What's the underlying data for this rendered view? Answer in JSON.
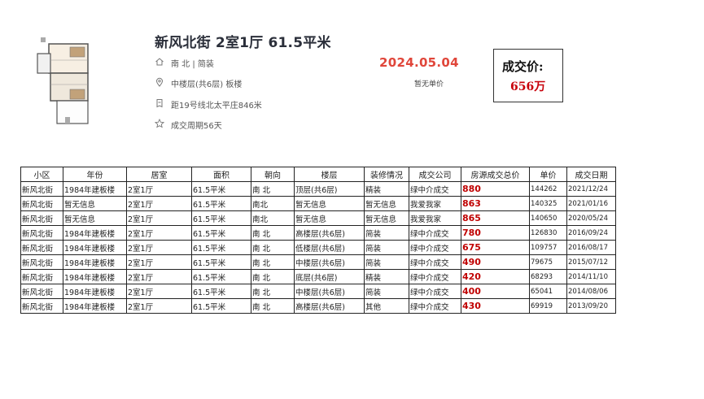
{
  "listing": {
    "title": "新风北街 2室1厅 61.5平米",
    "orientation": "南 北 | 简装",
    "floor": "中楼层(共6层) 板楼",
    "subway": "距19号线北太平庄846米",
    "cycle": "成交周期56天",
    "deal_date": "2024.05.04",
    "unit_price": "暂无单价",
    "price_label": "成交价:",
    "price_value": "656万",
    "icons": [
      "home-icon",
      "location-icon",
      "subway-icon",
      "star-icon"
    ]
  },
  "table": {
    "headers": [
      "小区",
      "年份",
      "居室",
      "面积",
      "朝向",
      "楼层",
      "装修情况",
      "成交公司",
      "房源成交总价",
      "单价",
      "成交日期"
    ],
    "rows": [
      [
        "新风北街",
        "1984年建板楼",
        "2室1厅",
        "61.5平米",
        "南 北",
        "顶层(共6层)",
        "精装",
        "绿中介成交",
        "880",
        "144262",
        "2021/12/24"
      ],
      [
        "新风北街",
        "暂无信息",
        "2室1厅",
        " 61.5平米",
        " 南北",
        "暂无信息",
        "暂无信息",
        "我爱我家",
        "863",
        "140325",
        "2021/01/16"
      ],
      [
        "新风北街",
        "暂无信息",
        "2室1厅",
        " 61.5平米",
        " 南北",
        "暂无信息",
        "暂无信息",
        "我爱我家",
        "865",
        "140650",
        "2020/05/24"
      ],
      [
        "新风北街",
        "1984年建板楼",
        "2室1厅",
        "61.5平米",
        "南 北",
        "高楼层(共6层)",
        "简装",
        "绿中介成交",
        "780",
        "126830",
        "2016/09/24"
      ],
      [
        "新风北街",
        "1984年建板楼",
        "2室1厅",
        "61.5平米",
        "南 北",
        "低楼层(共6层)",
        "简装",
        "绿中介成交",
        "675",
        "109757",
        "2016/08/17"
      ],
      [
        "新风北街",
        "1984年建板楼",
        "2室1厅",
        "61.5平米",
        "南 北",
        "中楼层(共6层)",
        "简装",
        "绿中介成交",
        "490",
        "79675",
        "2015/07/12"
      ],
      [
        "新风北街",
        "1984年建板楼",
        "2室1厅",
        "61.5平米",
        "南 北",
        "底层(共6层)",
        "精装",
        "绿中介成交",
        "420",
        "68293",
        "2014/11/10"
      ],
      [
        "新风北街",
        "1984年建板楼",
        "2室1厅",
        "61.5平米",
        "南 北",
        "中楼层(共6层)",
        "简装",
        "绿中介成交",
        "400",
        "65041",
        "2014/08/06"
      ],
      [
        "新风北街",
        "1984年建板楼",
        "2室1厅",
        "61.5平米",
        "南 北",
        "高楼层(共6层)",
        "其他",
        "绿中介成交",
        "430",
        "69919",
        "2013/09/20"
      ]
    ]
  },
  "colors": {
    "deal_date": "#e0463a",
    "price": "#c8000a",
    "table_price": "#c00000"
  }
}
